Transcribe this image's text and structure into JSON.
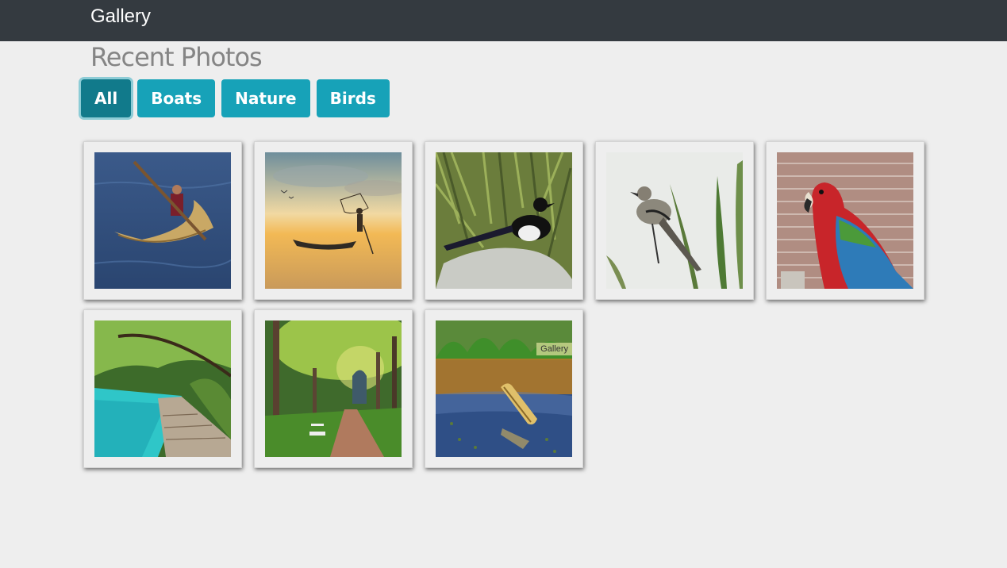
{
  "navbar": {
    "brand": "Gallery"
  },
  "page": {
    "title": "Recent Photos"
  },
  "filters": [
    {
      "label": "All",
      "active": true
    },
    {
      "label": "Boats",
      "active": false
    },
    {
      "label": "Nature",
      "active": false
    },
    {
      "label": "Birds",
      "active": false
    }
  ],
  "photos": [
    {
      "subject": "reed-boat-rower-image"
    },
    {
      "subject": "fisherman-sunset-boat-image"
    },
    {
      "subject": "magpie-on-rock-image"
    },
    {
      "subject": "mockingbird-on-grass-image"
    },
    {
      "subject": "parrot-brick-wall-image"
    },
    {
      "subject": "lake-boardwalk-image"
    },
    {
      "subject": "forest-path-bench-image"
    },
    {
      "subject": "canoe-on-lake-image",
      "tooltip": "Gallery"
    }
  ]
}
